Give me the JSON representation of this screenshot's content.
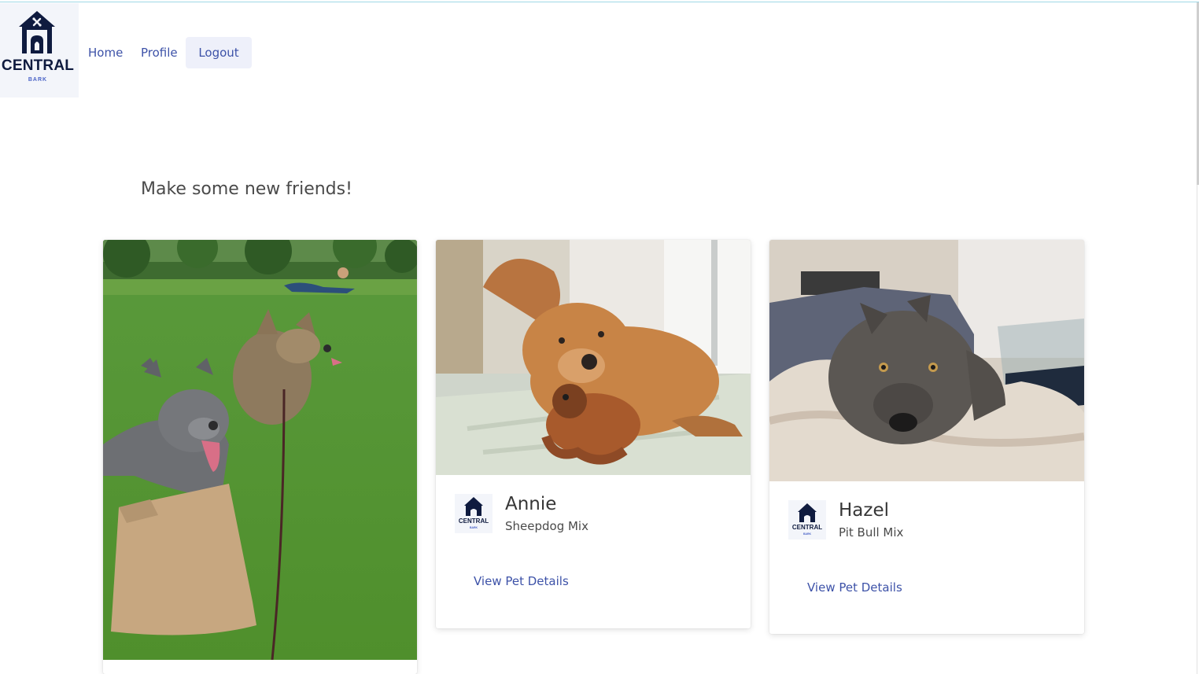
{
  "header": {
    "logo": {
      "brand": "CENTRAL",
      "sub": "BARK",
      "icon": "doghouse-icon",
      "colors": {
        "dark": "#0f1b3f",
        "accent": "#4a63c7"
      }
    },
    "nav": {
      "home": "Home",
      "profile": "Profile",
      "logout": "Logout"
    }
  },
  "main": {
    "heading": "Make some new friends!",
    "cards": [
      {
        "photo": "two-dogs-in-park-photo",
        "name": "",
        "breed": "",
        "link": ""
      },
      {
        "photo": "golden-dog-with-toy-photo",
        "avatar": "central-bark-logo",
        "name": "Annie",
        "breed": "Sheepdog Mix",
        "link": "View Pet Details"
      },
      {
        "photo": "gray-dog-on-blanket-photo",
        "avatar": "central-bark-logo",
        "name": "Hazel",
        "breed": "Pit Bull Mix",
        "link": "View Pet Details"
      }
    ]
  },
  "colors": {
    "link": "#3d52a8",
    "logout_bg": "#eef0fa",
    "text": "#363636"
  }
}
